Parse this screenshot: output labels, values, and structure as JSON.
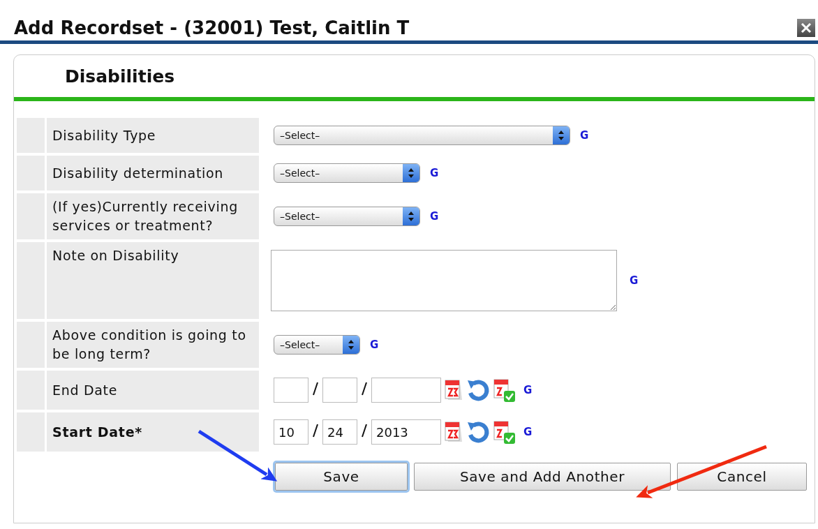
{
  "dialog": {
    "title": "Add Recordset - (32001) Test, Caitlin T",
    "section": "Disabilities"
  },
  "fields": [
    {
      "kind": "select",
      "label": "Disability Type",
      "value": "–Select–",
      "required": false,
      "help": "G"
    },
    {
      "kind": "select",
      "label": "Disability determination",
      "value": "–Select–",
      "required": false,
      "help": "G"
    },
    {
      "kind": "select",
      "label": "(If yes)Currently receiving services or treatment?",
      "value": "–Select–",
      "required": false,
      "help": "G"
    },
    {
      "kind": "textarea",
      "label": "Note on Disability",
      "required": false,
      "help": "G"
    },
    {
      "kind": "select",
      "label": "Above condition is going to be long term?",
      "value": "–Select–",
      "required": false,
      "help": "G"
    },
    {
      "kind": "date",
      "label": "End Date",
      "required": false,
      "help": "G"
    },
    {
      "kind": "date",
      "label": "Start Date",
      "month": "10",
      "day": "24",
      "year": "2013",
      "required": true,
      "required_mark": "*",
      "help": "G"
    }
  ],
  "buttons": [
    {
      "label": "Save",
      "focused": true
    },
    {
      "label": "Save and Add Another",
      "focused": false
    },
    {
      "label": "Cancel",
      "focused": false
    }
  ]
}
